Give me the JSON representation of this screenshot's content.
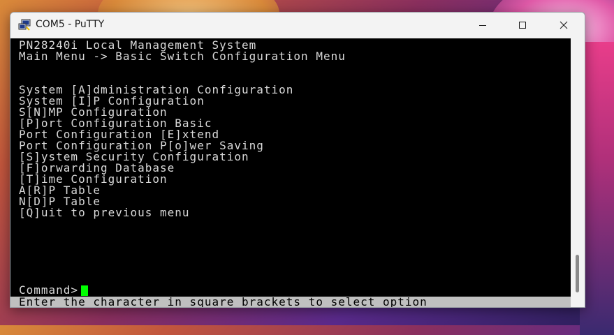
{
  "window": {
    "title": "COM5 - PuTTY",
    "icon": "putty-icon"
  },
  "controls": {
    "minimize_icon": "minimize-icon",
    "maximize_icon": "maximize-icon",
    "close_icon": "close-icon"
  },
  "terminal": {
    "header_line1": "PN28240i Local Management System",
    "header_line2": "Main Menu -> Basic Switch Configuration Menu",
    "menu_items": [
      "System [A]dministration Configuration",
      "System [I]P Configuration",
      "S[N]MP Configuration",
      "[P]ort Configuration Basic",
      "Port Configuration [E]xtend",
      "Port Configuration P[o]wer Saving",
      "[S]ystem Security Configuration",
      "[F]orwarding Database",
      "[T]ime Configuration",
      "A[R]P Table",
      "N[D]P Table",
      "[Q]uit to previous menu"
    ],
    "prompt": "Command> ",
    "status_line": "Enter the character in square brackets to select option",
    "cursor_color": "#00ff00",
    "background_color": "#000000",
    "text_color": "#d9d9d9"
  }
}
